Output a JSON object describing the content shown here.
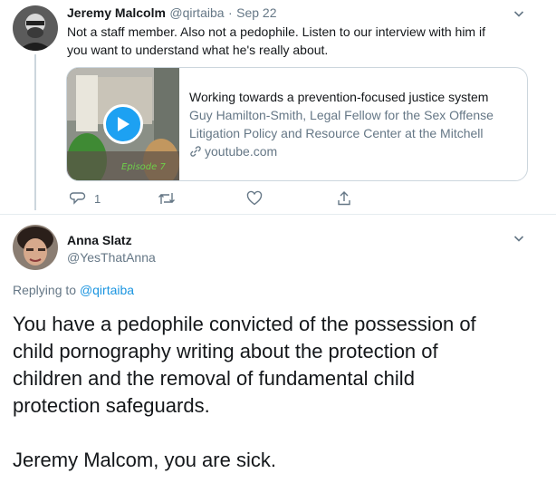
{
  "tweet1": {
    "author_name": "Jeremy Malcolm",
    "handle": "@qirtaiba",
    "separator": "·",
    "date": "Sep 22",
    "text_line1": "Not a staff member. Also not a pedophile. Listen to our interview with him if",
    "text_line2": "you want to understand what he's really about.",
    "card": {
      "title": "Working towards a prevention-focused justice system",
      "desc_line1": "Guy Hamilton-Smith, Legal Fellow for the Sex Offense",
      "desc_line2": "Litigation Policy and Resource Center at the Mitchell",
      "domain": "youtube.com",
      "thumb_caption": "Episode 7"
    },
    "actions": {
      "reply_count": "1"
    }
  },
  "tweet2": {
    "author_name": "Anna Slatz",
    "handle": "@YesThatAnna",
    "replying_prefix": "Replying to",
    "replying_to": "@qirtaiba",
    "body_line1": "You have a pedophile convicted of the possession of",
    "body_line2": "child pornography writing about the protection of",
    "body_line3": "children and the removal of fundamental child",
    "body_line4": "protection safeguards.",
    "body_line5": "Jeremy Malcom, you are sick."
  },
  "colors": {
    "accent": "#1da1f2",
    "link": "#1b95e0",
    "muted": "#657786",
    "border": "#ccd6dd"
  },
  "icons": [
    "reply-icon",
    "retweet-icon",
    "like-icon",
    "share-icon",
    "chevron-down-icon",
    "play-icon",
    "link-icon"
  ]
}
